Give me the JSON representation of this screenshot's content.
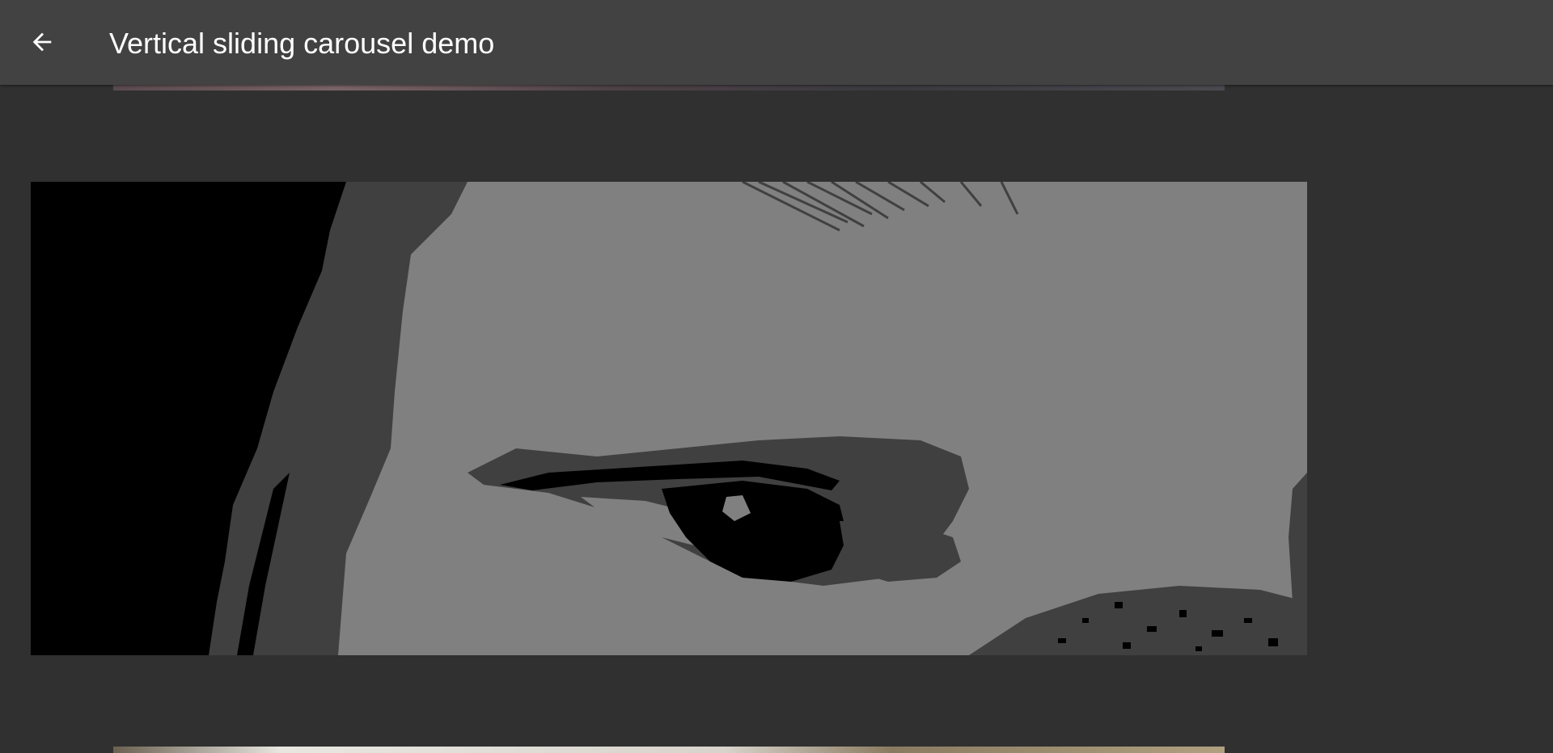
{
  "app_bar": {
    "title": "Vertical sliding carousel demo",
    "back_icon": "arrow-back-icon"
  },
  "colors": {
    "background": "#303030",
    "app_bar": "#424242",
    "title_text": "#ffffff"
  },
  "carousel": {
    "orientation": "vertical",
    "slides": [
      {
        "name": "previous-slide",
        "state": "partially-visible"
      },
      {
        "name": "current-slide",
        "state": "active",
        "image": "posterized-grayscale-eye-closeup"
      },
      {
        "name": "next-slide",
        "state": "partially-visible"
      }
    ]
  }
}
